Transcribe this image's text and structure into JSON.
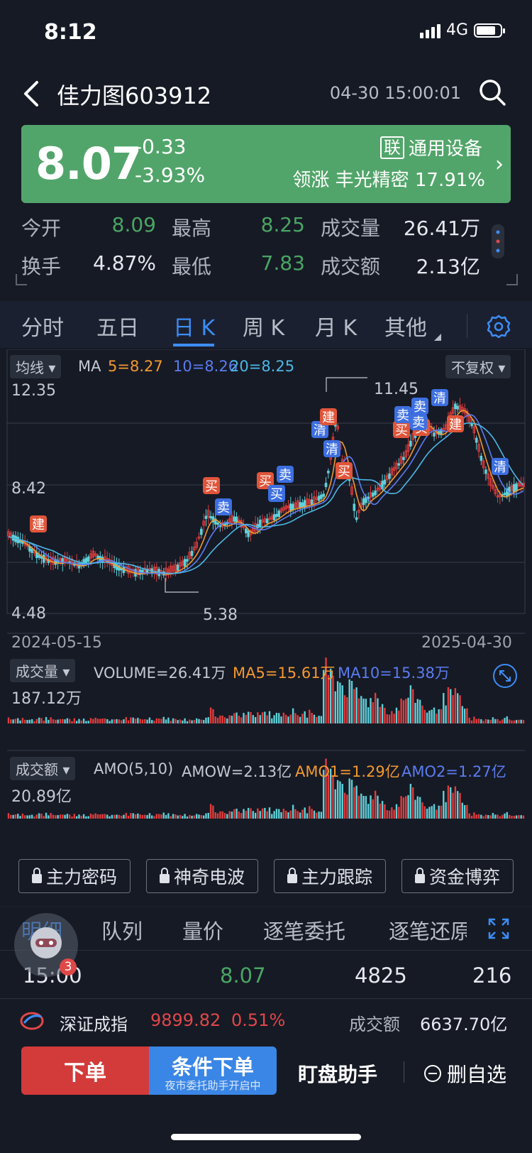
{
  "status": {
    "time": "8:12",
    "network": "4G"
  },
  "header": {
    "title": "佳力图603912",
    "timestamp": "04-30 15:00:01"
  },
  "quote": {
    "price": "8.07",
    "change": "-0.33",
    "change_pct": "-3.93%",
    "sector_badge": "联",
    "sector": "通用设备",
    "leader": "领涨 丰光精密 17.91%",
    "banner_color": "#52a56a"
  },
  "stats": {
    "open_label": "今开",
    "open": "8.09",
    "high_label": "最高",
    "high": "8.25",
    "volume_label": "成交量",
    "volume": "26.41万",
    "turnover_label": "换手",
    "turnover": "4.87%",
    "low_label": "最低",
    "low": "7.83",
    "amount_label": "成交额",
    "amount": "2.13亿"
  },
  "tabs": [
    {
      "label": "分时"
    },
    {
      "label": "五日"
    },
    {
      "label": "日 K"
    },
    {
      "label": "周 K"
    },
    {
      "label": "月 K"
    },
    {
      "label": "其他"
    }
  ],
  "active_tab": "日 K",
  "kline": {
    "indicator_chip": "均线",
    "ma_label": "MA",
    "ma5": "5=8.27",
    "ma10": "10=8.26",
    "ma20": "20=8.25",
    "adjust_chip": "不复权",
    "y_top": "12.35",
    "y_mid": "8.42",
    "y_bottom": "4.48",
    "peak": "11.45",
    "trough": "5.38",
    "start_date": "2024-05-15",
    "end_date": "2025-04-30",
    "signal_labels": {
      "build": "建",
      "buy": "买",
      "sell": "卖",
      "clear": "清"
    },
    "colors": {
      "ma5": "#f3992f",
      "ma10": "#5b7cf0",
      "ma20": "#4cb8e6",
      "up": "#e03c3c",
      "down": "#5fd0d8"
    }
  },
  "volume": {
    "chip": "成交量",
    "volume": "VOLUME=26.41万",
    "ma5": "MA5=15.61万",
    "ma10": "MA10=15.38万",
    "y_max": "187.12万"
  },
  "amount": {
    "chip": "成交额",
    "params": "AMO(5,10)",
    "amow": "AMOW=2.13亿",
    "amo1": "AMO1=1.29亿",
    "amo2": "AMO2=1.27亿",
    "y_max": "20.89亿"
  },
  "tools": [
    {
      "label": "主力密码"
    },
    {
      "label": "神奇电波"
    },
    {
      "label": "主力跟踪"
    },
    {
      "label": "资金博弈"
    }
  ],
  "detail_tabs": [
    {
      "label": "明细"
    },
    {
      "label": "队列"
    },
    {
      "label": "量价"
    },
    {
      "label": "逐笔委托"
    },
    {
      "label": "逐笔还原"
    }
  ],
  "trade_row": {
    "time": "15:00",
    "price": "8.07",
    "volume": "4825",
    "count": "216"
  },
  "badge_count": "3",
  "index_row": {
    "name": "深证成指",
    "value": "9899.82",
    "pct": "0.51%",
    "amount_label": "成交额",
    "amount": "6637.70亿"
  },
  "bottom": {
    "order": "下单",
    "conditional": "条件下单",
    "conditional_sub": "夜市委托助手开启中",
    "assistant": "盯盘助手",
    "remove": "删自选"
  }
}
